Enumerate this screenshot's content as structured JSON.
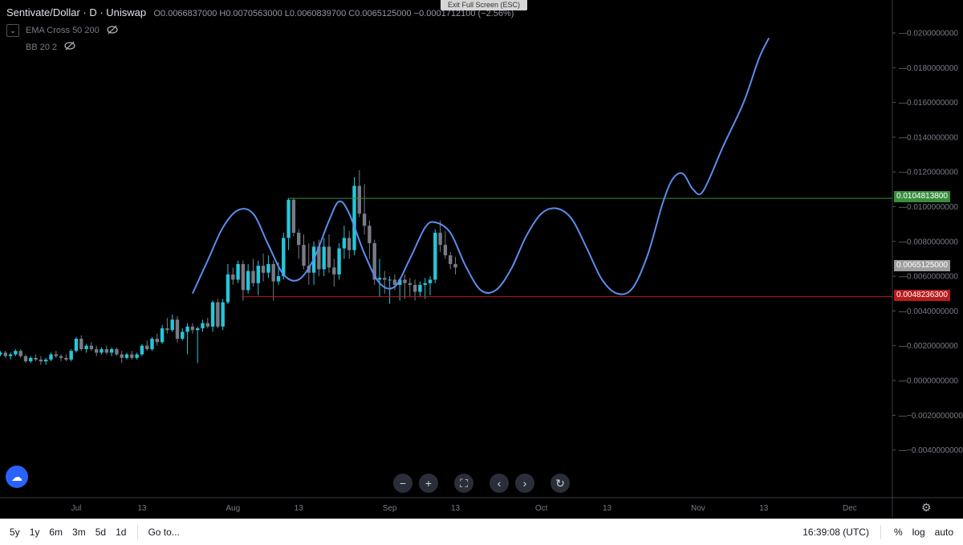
{
  "header": {
    "symbol": "Sentivate/Dollar · D · Uniswap",
    "ohlc": "O0.0066837000  H0.0070563000  L0.0060839700  C0.0065125000  −0.0001712100 (−2.56%)",
    "exit_fullscreen": "Exit Full Screen (ESC)"
  },
  "indicators": [
    {
      "label": "EMA Cross 50 200"
    },
    {
      "label": "BB 20 2"
    }
  ],
  "price_tags": {
    "resistance": "0.0104813800",
    "last": "0.0065125000",
    "support": "0.0048236300"
  },
  "colors": {
    "up": "#26c6da",
    "down": "#787b86",
    "resistance": "#388e3c",
    "support": "#b71c1c",
    "projection": "#5b8dee",
    "last_tag": "#9e9e9e"
  },
  "nav_buttons": [
    "−",
    "+",
    "⛶",
    "‹",
    "›",
    "↻"
  ],
  "bottom_bar": {
    "ranges": [
      "5y",
      "1y",
      "6m",
      "3m",
      "5d",
      "1d"
    ],
    "goto": "Go to...",
    "time": "16:39:08 (UTC)",
    "percent": "%",
    "log": "log",
    "auto": "auto"
  },
  "chart_data": {
    "type": "candlestick",
    "y_ticks": [
      "0.0200000000",
      "0.0180000000",
      "0.0160000000",
      "0.0140000000",
      "0.0120000000",
      "0.0100000000",
      "0.0080000000",
      "0.0060000000",
      "0.0040000000",
      "0.0020000000",
      "0.0000000000",
      "−0.0020000000",
      "−0.0040000000"
    ],
    "y_tick_values": [
      0.02,
      0.018,
      0.016,
      0.014,
      0.012,
      0.01,
      0.008,
      0.006,
      0.004,
      0.002,
      0,
      -0.002,
      -0.004
    ],
    "x_ticks": [
      "Jul",
      "13",
      "Aug",
      "13",
      "Sep",
      "13",
      "Oct",
      "13",
      "Nov",
      "13",
      "Dec"
    ],
    "x_tick_days": [
      30,
      43,
      61,
      74,
      92,
      105,
      122,
      135,
      153,
      166,
      183
    ],
    "first_day": 13,
    "ylim": [
      -0.0055,
      0.0205
    ],
    "resistance_level": 0.01048138,
    "support_level": 0.00482363,
    "candles": [
      [
        0.0013,
        0.0015,
        0.0012,
        0.0014
      ],
      [
        0.0014,
        0.0016,
        0.0013,
        0.0015
      ],
      [
        0.0015,
        0.0017,
        0.0014,
        0.0016
      ],
      [
        0.0016,
        0.0017,
        0.0013,
        0.0014
      ],
      [
        0.0014,
        0.0016,
        0.0012,
        0.0015
      ],
      [
        0.0015,
        0.0018,
        0.0014,
        0.0017
      ],
      [
        0.0017,
        0.0018,
        0.0013,
        0.0014
      ],
      [
        0.0014,
        0.0015,
        0.001,
        0.0011
      ],
      [
        0.0011,
        0.0014,
        0.001,
        0.0013
      ],
      [
        0.0013,
        0.0015,
        0.0011,
        0.0012
      ],
      [
        0.0012,
        0.0014,
        0.0009,
        0.0011
      ],
      [
        0.0011,
        0.0013,
        0.0009,
        0.0012
      ],
      [
        0.0012,
        0.0016,
        0.0011,
        0.0015
      ],
      [
        0.0015,
        0.0017,
        0.0013,
        0.0014
      ],
      [
        0.0014,
        0.0015,
        0.0011,
        0.0013
      ],
      [
        0.0013,
        0.0015,
        0.0011,
        0.0012
      ],
      [
        0.0012,
        0.0018,
        0.0011,
        0.0017
      ],
      [
        0.0017,
        0.0025,
        0.0016,
        0.0024
      ],
      [
        0.0024,
        0.0026,
        0.0017,
        0.0018
      ],
      [
        0.0018,
        0.0021,
        0.0016,
        0.002
      ],
      [
        0.002,
        0.0022,
        0.0017,
        0.0018
      ],
      [
        0.0018,
        0.002,
        0.0014,
        0.0016
      ],
      [
        0.0016,
        0.0019,
        0.0015,
        0.0018
      ],
      [
        0.0018,
        0.002,
        0.0015,
        0.0016
      ],
      [
        0.0016,
        0.0019,
        0.0014,
        0.0018
      ],
      [
        0.0018,
        0.0019,
        0.0014,
        0.0015
      ],
      [
        0.0015,
        0.0017,
        0.001,
        0.0013
      ],
      [
        0.0013,
        0.0016,
        0.0012,
        0.0015
      ],
      [
        0.0015,
        0.0017,
        0.0012,
        0.0013
      ],
      [
        0.0013,
        0.0016,
        0.0012,
        0.0015
      ],
      [
        0.0015,
        0.0021,
        0.0014,
        0.002
      ],
      [
        0.002,
        0.0023,
        0.0017,
        0.0018
      ],
      [
        0.0018,
        0.0025,
        0.0017,
        0.0024
      ],
      [
        0.0024,
        0.0027,
        0.002,
        0.0022
      ],
      [
        0.0022,
        0.0032,
        0.0021,
        0.003
      ],
      [
        0.003,
        0.0036,
        0.0027,
        0.0029
      ],
      [
        0.0029,
        0.0038,
        0.0028,
        0.0035
      ],
      [
        0.0035,
        0.0037,
        0.0022,
        0.0024
      ],
      [
        0.0024,
        0.003,
        0.0023,
        0.0028
      ],
      [
        0.0028,
        0.0033,
        0.0015,
        0.0031
      ],
      [
        0.0031,
        0.0033,
        0.0027,
        0.0029
      ],
      [
        0.0029,
        0.0031,
        0.001,
        0.003
      ],
      [
        0.003,
        0.0035,
        0.0028,
        0.0033
      ],
      [
        0.0033,
        0.0036,
        0.003,
        0.0031
      ],
      [
        0.0031,
        0.0046,
        0.0028,
        0.0045
      ],
      [
        0.0045,
        0.0047,
        0.003,
        0.0031
      ],
      [
        0.0031,
        0.0047,
        0.0029,
        0.0045
      ],
      [
        0.0045,
        0.0067,
        0.0044,
        0.0061
      ],
      [
        0.0061,
        0.0065,
        0.0055,
        0.0058
      ],
      [
        0.0058,
        0.0069,
        0.0056,
        0.0067
      ],
      [
        0.0067,
        0.0069,
        0.0046,
        0.0052
      ],
      [
        0.0052,
        0.0067,
        0.005,
        0.0063
      ],
      [
        0.0063,
        0.007,
        0.0054,
        0.0056
      ],
      [
        0.0056,
        0.0069,
        0.0049,
        0.0066
      ],
      [
        0.0066,
        0.0073,
        0.0057,
        0.0062
      ],
      [
        0.0062,
        0.0072,
        0.0059,
        0.0067
      ],
      [
        0.0067,
        0.0069,
        0.0046,
        0.0057
      ],
      [
        0.0057,
        0.0068,
        0.0055,
        0.006
      ],
      [
        0.006,
        0.0085,
        0.0058,
        0.0082
      ],
      [
        0.0082,
        0.0105,
        0.0075,
        0.0104
      ],
      [
        0.0104,
        0.0105,
        0.0083,
        0.0085
      ],
      [
        0.0085,
        0.0087,
        0.007,
        0.0078
      ],
      [
        0.0078,
        0.0084,
        0.0064,
        0.0066
      ],
      [
        0.0066,
        0.0079,
        0.0055,
        0.0062
      ],
      [
        0.0062,
        0.008,
        0.0055,
        0.0077
      ],
      [
        0.0077,
        0.0081,
        0.006,
        0.0064
      ],
      [
        0.0064,
        0.0082,
        0.006,
        0.0077
      ],
      [
        0.0077,
        0.0084,
        0.0062,
        0.0065
      ],
      [
        0.0065,
        0.007,
        0.0054,
        0.0061
      ],
      [
        0.0061,
        0.0079,
        0.0058,
        0.0076
      ],
      [
        0.0076,
        0.0089,
        0.007,
        0.0082
      ],
      [
        0.0082,
        0.0086,
        0.007,
        0.0075
      ],
      [
        0.0075,
        0.0117,
        0.0072,
        0.0112
      ],
      [
        0.0112,
        0.0121,
        0.0094,
        0.0096
      ],
      [
        0.0096,
        0.0113,
        0.0084,
        0.0089
      ],
      [
        0.0089,
        0.0092,
        0.007,
        0.0079
      ],
      [
        0.0079,
        0.0081,
        0.0055,
        0.0058
      ],
      [
        0.0058,
        0.007,
        0.0048,
        0.0059
      ],
      [
        0.0059,
        0.0063,
        0.005,
        0.0058
      ],
      [
        0.0058,
        0.006,
        0.0044,
        0.0058
      ],
      [
        0.0058,
        0.0061,
        0.0052,
        0.0055
      ],
      [
        0.0055,
        0.0059,
        0.0046,
        0.0058
      ],
      [
        0.0058,
        0.0061,
        0.0047,
        0.0056
      ],
      [
        0.0056,
        0.0059,
        0.0048,
        0.0055
      ],
      [
        0.0055,
        0.0058,
        0.0046,
        0.0051
      ],
      [
        0.0051,
        0.0057,
        0.0048,
        0.0055
      ],
      [
        0.0055,
        0.0059,
        0.0047,
        0.0056
      ],
      [
        0.0056,
        0.006,
        0.0049,
        0.0058
      ],
      [
        0.0058,
        0.0087,
        0.0056,
        0.0085
      ],
      [
        0.0085,
        0.0092,
        0.0074,
        0.0078
      ],
      [
        0.0078,
        0.0086,
        0.007,
        0.0072
      ],
      [
        0.0072,
        0.0074,
        0.0064,
        0.0067
      ],
      [
        0.0067,
        0.0071,
        0.0061,
        0.0065
      ]
    ],
    "projection": [
      [
        53,
        0.005
      ],
      [
        56,
        0.0069
      ],
      [
        59,
        0.0088
      ],
      [
        62,
        0.0098
      ],
      [
        65,
        0.0096
      ],
      [
        68,
        0.0078
      ],
      [
        71,
        0.0061
      ],
      [
        74,
        0.0058
      ],
      [
        77,
        0.007
      ],
      [
        80,
        0.0092
      ],
      [
        82,
        0.0103
      ],
      [
        84,
        0.0096
      ],
      [
        87,
        0.0073
      ],
      [
        90,
        0.0056
      ],
      [
        93,
        0.0054
      ],
      [
        96,
        0.007
      ],
      [
        99,
        0.0088
      ],
      [
        101,
        0.0091
      ],
      [
        104,
        0.0085
      ],
      [
        107,
        0.0066
      ],
      [
        110,
        0.0052
      ],
      [
        113,
        0.0052
      ],
      [
        116,
        0.0064
      ],
      [
        119,
        0.0083
      ],
      [
        122,
        0.0096
      ],
      [
        125,
        0.0099
      ],
      [
        128,
        0.0093
      ],
      [
        131,
        0.0076
      ],
      [
        134,
        0.0058
      ],
      [
        137,
        0.005
      ],
      [
        140,
        0.0053
      ],
      [
        143,
        0.0072
      ],
      [
        146,
        0.0102
      ],
      [
        148,
        0.0116
      ],
      [
        150,
        0.0119
      ],
      [
        152,
        0.011
      ],
      [
        154,
        0.0109
      ],
      [
        158,
        0.0135
      ],
      [
        162,
        0.016
      ],
      [
        165,
        0.0185
      ],
      [
        167,
        0.0197
      ]
    ]
  }
}
